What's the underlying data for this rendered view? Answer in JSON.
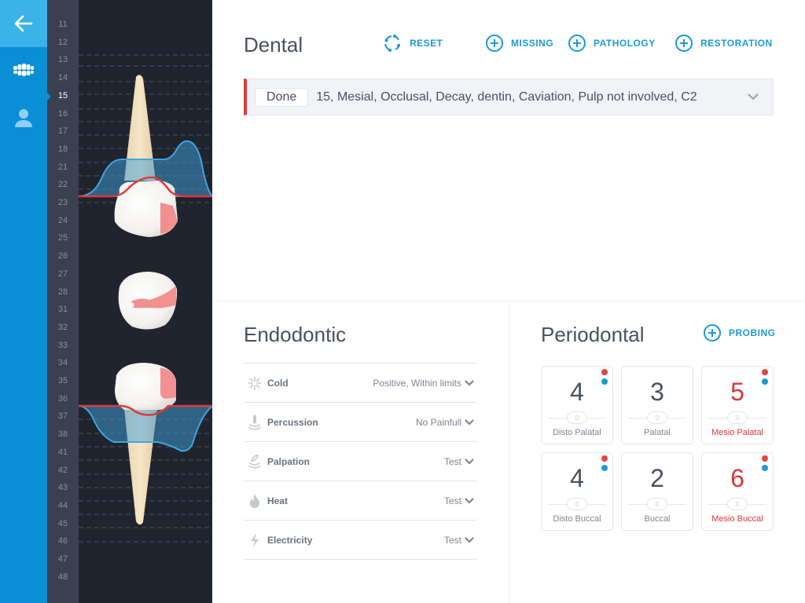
{
  "nav": {
    "back_icon": "arrow-left-icon",
    "items": [
      {
        "icon": "teeth-icon",
        "label": "Teeth"
      },
      {
        "icon": "user-icon",
        "label": "Patient"
      }
    ]
  },
  "ruler": {
    "numbers": [
      "11",
      "12",
      "13",
      "14",
      "15",
      "16",
      "17",
      "18",
      "21",
      "22",
      "23",
      "24",
      "25",
      "26",
      "27",
      "28",
      "31",
      "32",
      "33",
      "34",
      "35",
      "36",
      "37",
      "38",
      "41",
      "42",
      "43",
      "44",
      "45",
      "46",
      "47",
      "48"
    ],
    "active": "15"
  },
  "dental": {
    "title": "Dental",
    "actions": {
      "reset": "RESET",
      "missing": "MISSING",
      "pathology": "PATHOLOGY",
      "restoration": "RESTORATION"
    },
    "record": {
      "status_button": "Done",
      "description": "15, Mesial, Occlusal, Decay, dentin, Caviation, Pulp not involved, C2"
    }
  },
  "endodontic": {
    "title": "Endodontic",
    "tests": [
      {
        "icon": "snowflake-icon",
        "label": "Cold",
        "value": "Positive, Within limits"
      },
      {
        "icon": "percussion-icon",
        "label": "Percussion",
        "value": "No Painfull"
      },
      {
        "icon": "palpation-icon",
        "label": "Palpation",
        "value": "Test"
      },
      {
        "icon": "flame-icon",
        "label": "Heat",
        "value": "Test"
      },
      {
        "icon": "lightning-icon",
        "label": "Electricity",
        "value": "Test"
      }
    ]
  },
  "periodontal": {
    "title": "Periodontal",
    "action": "PROBING",
    "sites": [
      {
        "value": "4",
        "recession": "0",
        "name": "Disto Palatal",
        "alert": false,
        "dots": true
      },
      {
        "value": "3",
        "recession": "0",
        "name": "Palatal",
        "alert": false,
        "dots": false
      },
      {
        "value": "5",
        "recession": "0",
        "name": "Mesio Palatal",
        "alert": true,
        "dots": true
      },
      {
        "value": "4",
        "recession": "0",
        "name": "Disto Buccal",
        "alert": false,
        "dots": true
      },
      {
        "value": "2",
        "recession": "0",
        "name": "Buccal",
        "alert": false,
        "dots": false
      },
      {
        "value": "6",
        "recession": "0",
        "name": "Mesio Buccal",
        "alert": true,
        "dots": true
      }
    ]
  },
  "colors": {
    "accent": "#1b9ad6",
    "alert": "#d9373a",
    "nav_bg": "#0a8fd6",
    "chart_bg": "#20242f"
  }
}
